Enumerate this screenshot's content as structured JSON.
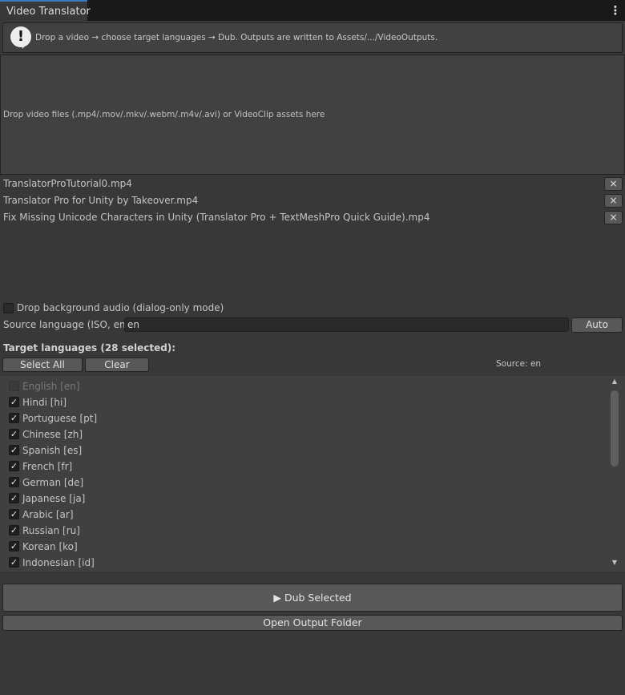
{
  "window": {
    "tab_title": "Video Translator",
    "menu_icon": "kebab-menu-icon"
  },
  "help": {
    "icon": "exclamation-icon",
    "text": "Drop a video → choose target languages → Dub. Outputs are written to Assets/.../VideoOutputs."
  },
  "dropzone": {
    "text": "Drop video files (.mp4/.mov/.mkv/.webm/.m4v/.avi) or VideoClip assets here"
  },
  "files": [
    {
      "name": "TranslatorProTutorial0.mp4",
      "remove": "×"
    },
    {
      "name": "Translator Pro for Unity by Takeover.mp4",
      "remove": "×"
    },
    {
      "name": "Fix Missing Unicode Characters in Unity (Translator Pro + TextMeshPro Quick Guide).mp4",
      "remove": "×"
    }
  ],
  "options": {
    "drop_background_label": "Drop background audio (dialog-only mode)",
    "drop_background_checked": false,
    "source_label": "Source language (ISO, empty",
    "source_value": "en",
    "auto_label": "Auto"
  },
  "targets": {
    "title": "Target languages (28 selected):",
    "select_all_label": "Select All",
    "clear_label": "Clear",
    "source_tag": "Source: en",
    "languages": [
      {
        "label": "English  [en]",
        "checked": false,
        "disabled": true
      },
      {
        "label": "Hindi  [hi]",
        "checked": true
      },
      {
        "label": "Portuguese  [pt]",
        "checked": true
      },
      {
        "label": "Chinese  [zh]",
        "checked": true
      },
      {
        "label": "Spanish  [es]",
        "checked": true
      },
      {
        "label": "French  [fr]",
        "checked": true
      },
      {
        "label": "German  [de]",
        "checked": true
      },
      {
        "label": "Japanese  [ja]",
        "checked": true
      },
      {
        "label": "Arabic  [ar]",
        "checked": true
      },
      {
        "label": "Russian  [ru]",
        "checked": true
      },
      {
        "label": "Korean  [ko]",
        "checked": true
      },
      {
        "label": "Indonesian  [id]",
        "checked": true
      }
    ],
    "scroll_up": "▲",
    "scroll_down": "▼"
  },
  "actions": {
    "dub_label": "▶ Dub Selected",
    "open_folder_label": "Open Output Folder"
  }
}
